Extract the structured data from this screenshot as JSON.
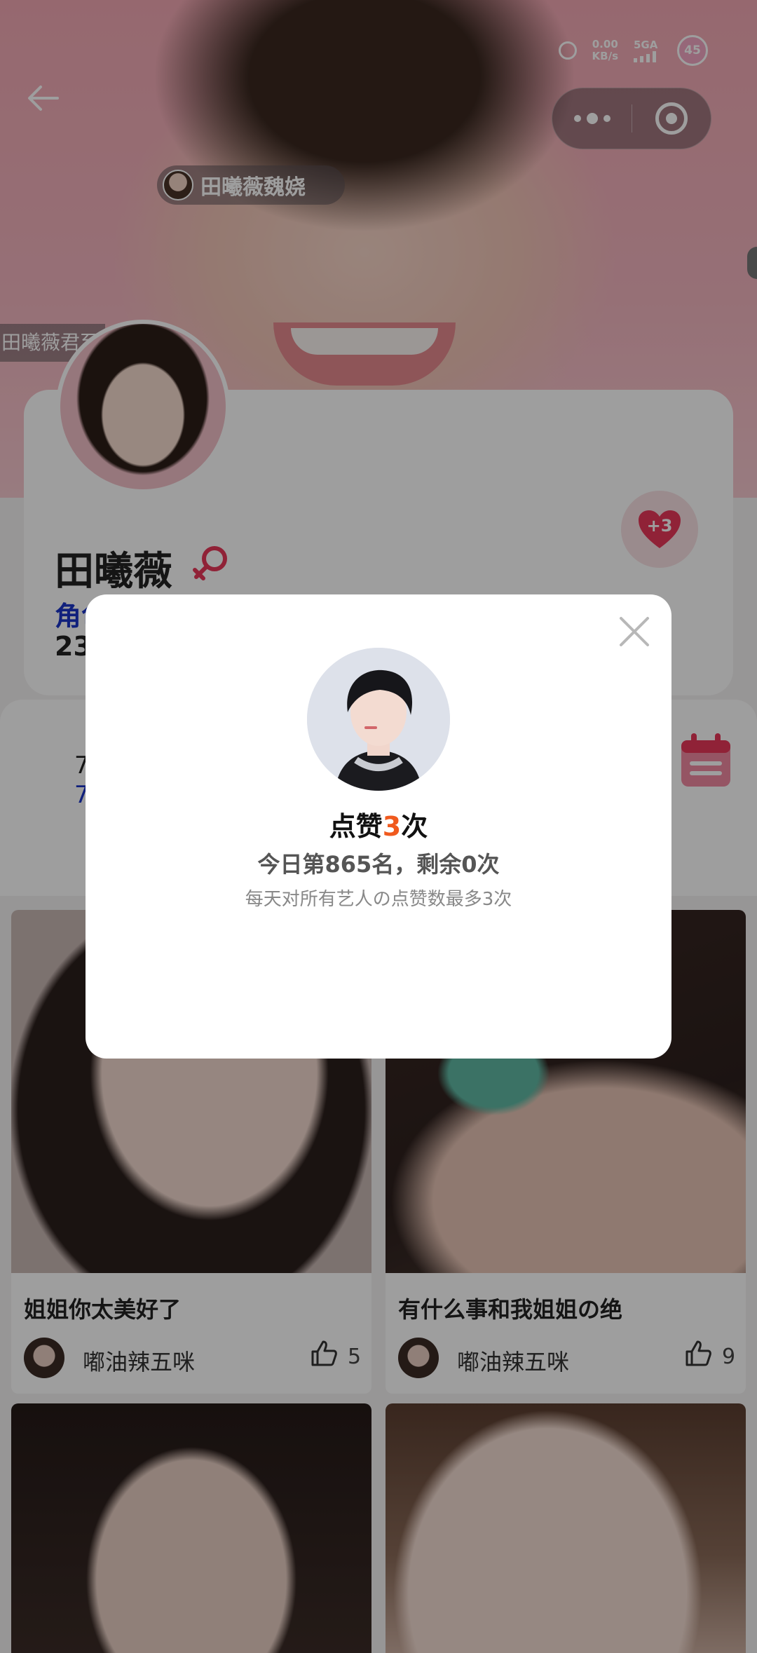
{
  "status_bar": {
    "speed_value": "0.00",
    "speed_unit": "KB/s",
    "network": "5GA",
    "battery": "45"
  },
  "header": {
    "tag_name": "田曦薇魏娆",
    "scroll_tag": "田曦薇君至"
  },
  "profile": {
    "name": "田曦薇",
    "role_prefix": "角色",
    "number_prefix": "23",
    "heart_badge": "+3"
  },
  "stats": {
    "line_a": "7",
    "line_b": "7"
  },
  "posts": [
    {
      "title": "姐姐你太美好了",
      "author": "嘟油辣五咪",
      "likes": "5"
    },
    {
      "title": "有什么事和我姐姐の绝",
      "author": "嘟油辣五咪",
      "likes": "9"
    }
  ],
  "modal": {
    "title_before": "点赞",
    "title_count": "3",
    "title_after": "次",
    "rank_text": "今日第865名，剩余0次",
    "note_text": "每天对所有艺人の点赞数最多3次"
  },
  "colors": {
    "accent_red": "#e8385a",
    "highlight_orange": "#f05a1e",
    "role_blue": "#1a35c8"
  }
}
